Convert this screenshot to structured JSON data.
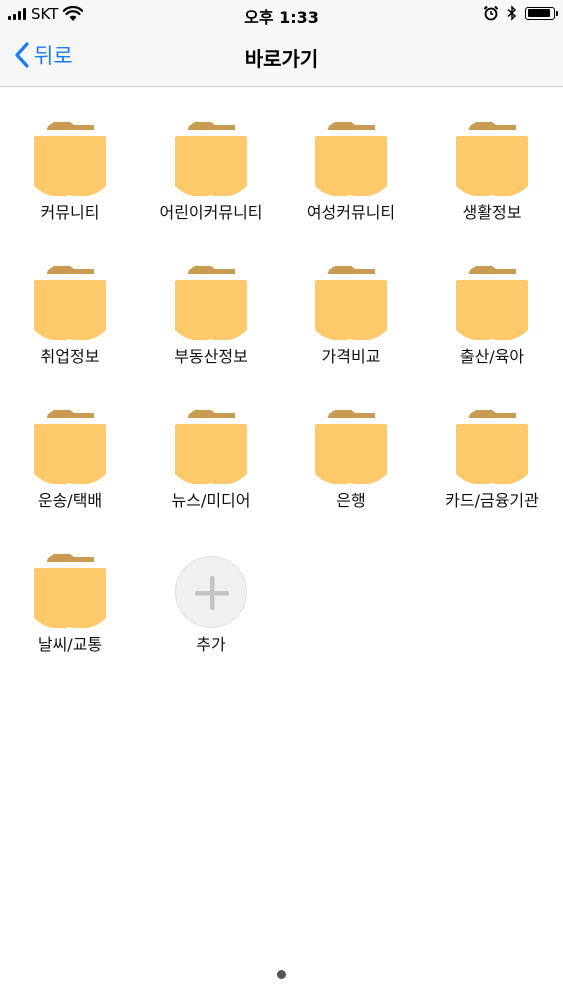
{
  "status": {
    "carrier": "SKT",
    "time": "오후 1:33",
    "battery_level": 0.9
  },
  "nav": {
    "back_label": "뒤로",
    "title": "바로가기"
  },
  "shortcuts": [
    {
      "label": "커뮤니티",
      "icon": "folder-icon"
    },
    {
      "label": "어린이커뮤니티",
      "icon": "folder-icon"
    },
    {
      "label": "여성커뮤니티",
      "icon": "folder-icon"
    },
    {
      "label": "생활정보",
      "icon": "folder-icon"
    },
    {
      "label": "취업정보",
      "icon": "folder-icon"
    },
    {
      "label": "부동산정보",
      "icon": "folder-icon"
    },
    {
      "label": "가격비교",
      "icon": "folder-icon"
    },
    {
      "label": "출산/육아",
      "icon": "folder-icon"
    },
    {
      "label": "운송/택배",
      "icon": "folder-icon"
    },
    {
      "label": "뉴스/미디어",
      "icon": "folder-icon"
    },
    {
      "label": "은행",
      "icon": "folder-icon"
    },
    {
      "label": "카드/금융기관",
      "icon": "folder-icon"
    },
    {
      "label": "날씨/교통",
      "icon": "folder-icon"
    }
  ],
  "add": {
    "label": "추가",
    "icon": "plus-icon"
  },
  "colors": {
    "folder_body": "#fdc96b",
    "folder_tab": "#c89a52",
    "accent": "#1a7cf4",
    "plus": "#c4c4c7"
  }
}
